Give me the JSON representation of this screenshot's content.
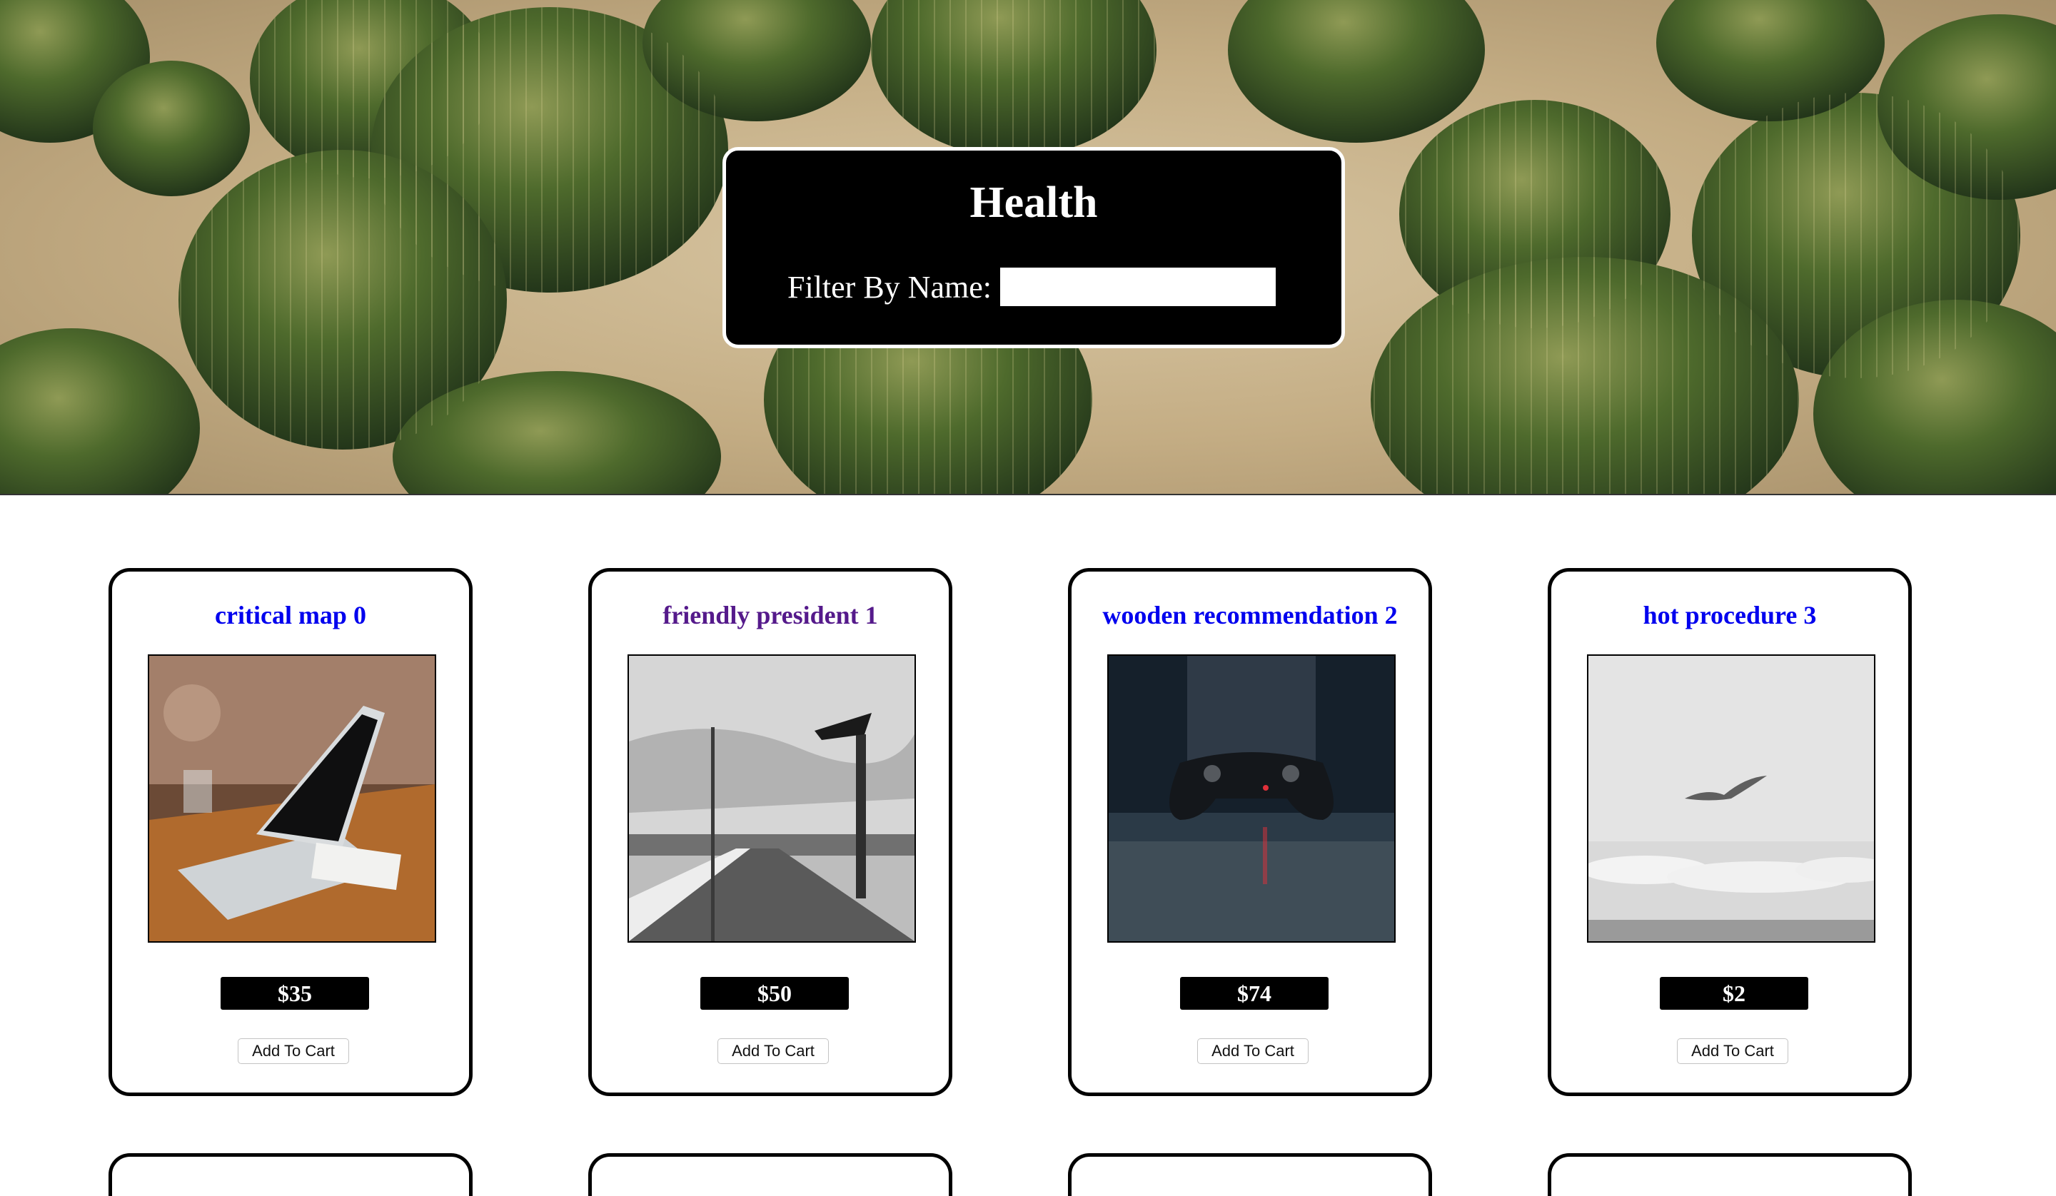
{
  "header": {
    "title": "Health",
    "filter_label": "Filter By Name:",
    "filter_value": "",
    "filter_placeholder": ""
  },
  "products": [
    {
      "name": "critical map 0",
      "price": "$35",
      "button": "Add To Cart",
      "image": "laptop-on-desk-photo",
      "link_visited": false
    },
    {
      "name": "friendly president 1",
      "price": "$50",
      "button": "Add To Cart",
      "image": "pier-lamppost-bw-photo",
      "link_visited": true
    },
    {
      "name": "wooden recommendation 2",
      "price": "$74",
      "button": "Add To Cart",
      "image": "game-controller-photo",
      "link_visited": false
    },
    {
      "name": "hot procedure 3",
      "price": "$2",
      "button": "Add To Cart",
      "image": "seagull-sky-bw-photo",
      "link_visited": false
    }
  ],
  "colors": {
    "link": "#0000ee",
    "visited_link": "#551a8b",
    "panel": "#000000",
    "price_badge": "#000000"
  },
  "hero_image": "golden-barrel-cactus-field-photo"
}
